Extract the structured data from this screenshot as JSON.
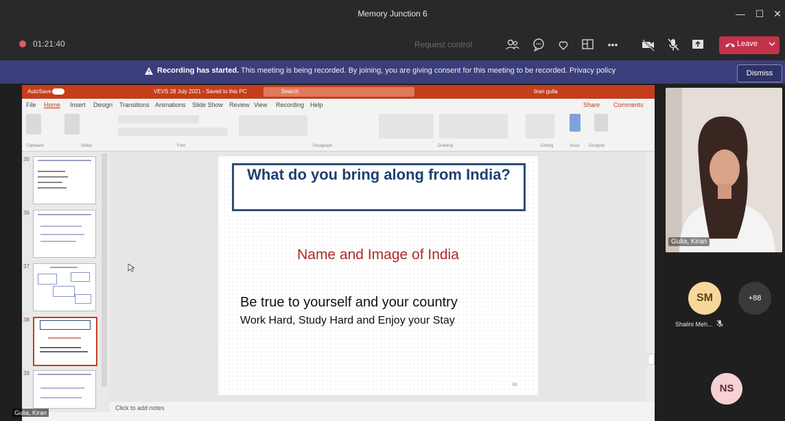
{
  "window": {
    "title": "Memory Junction 6",
    "minimize": "—",
    "maximize": "☐",
    "close": "✕"
  },
  "meeting": {
    "timer": "01:21:40",
    "request_control": "Request control",
    "leave_label": "Leave",
    "leave_color": "#c4314b"
  },
  "banner": {
    "bold": "Recording has started.",
    "text": " This meeting is being recorded. By joining, you are giving consent for this meeting to be recorded. Privacy policy",
    "dismiss": "Dismiss"
  },
  "ppt": {
    "autosave": "AutoSave",
    "filename": "VEVS 28 July 2021 - Saved to this PC",
    "search": "Search",
    "user": "tiran gulia",
    "tabs": [
      "File",
      "Home",
      "Insert",
      "Design",
      "Transitions",
      "Animations",
      "Slide Show",
      "Review",
      "View",
      "Recording",
      "Help"
    ],
    "share": "Share",
    "comments": "Comments",
    "groups": [
      "Clipboard",
      "Slides",
      "Font",
      "Paragraph",
      "Drawing",
      "Editing",
      "Voice",
      "Designer"
    ],
    "thumb_numbers": [
      "35",
      "36",
      "37",
      "38",
      "39"
    ],
    "notes": "Click to add notes",
    "slide_number": "38"
  },
  "slide": {
    "title": "What do you bring along from India?",
    "subtitle": "Name and Image of India",
    "line1": "Be true to yourself and your country",
    "line2": "Work Hard, Study Hard and Enjoy your Stay"
  },
  "participants": {
    "video_name": "Gulia, Kiran",
    "sm_initials": "SM",
    "sm_name": "Shalini Meh...",
    "more": "+88",
    "ns_initials": "NS",
    "bottom_name": "Gulia, Kiran"
  }
}
